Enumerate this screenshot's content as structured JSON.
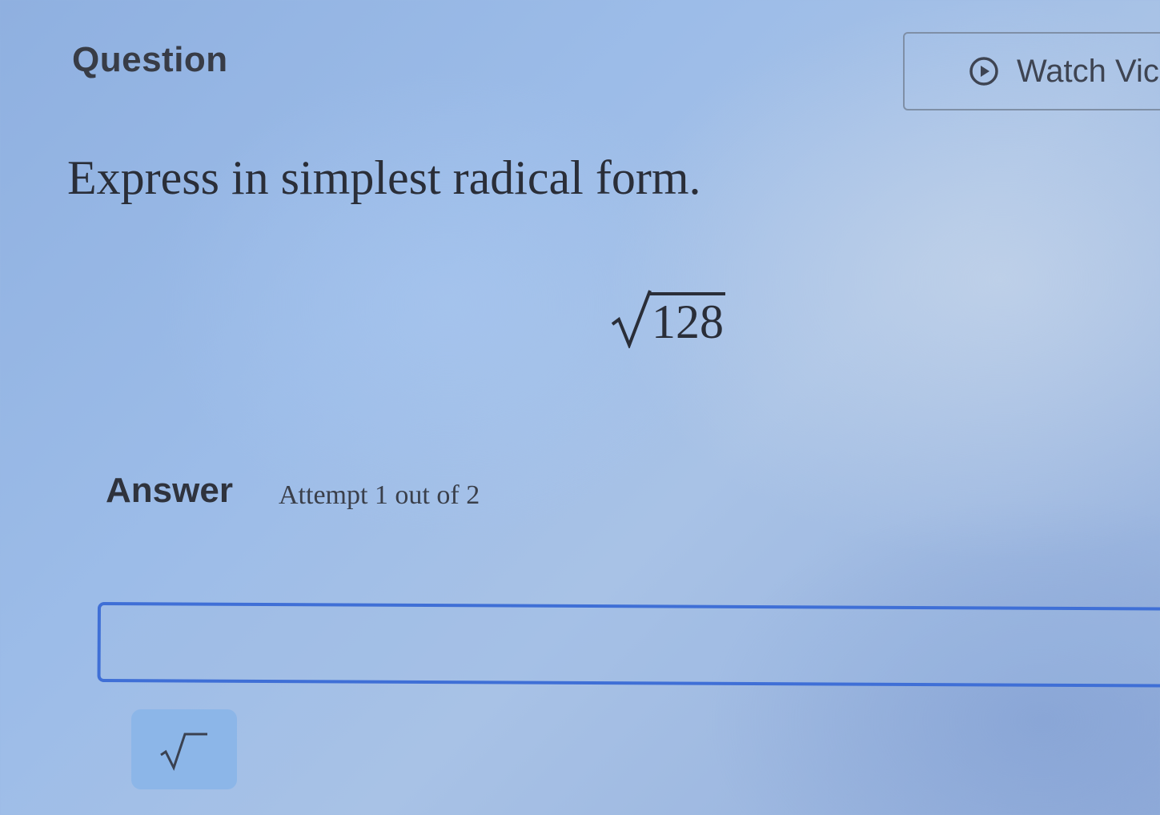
{
  "header": {
    "title": "Question",
    "watch_video_label": "Watch Vic"
  },
  "question": {
    "prompt": "Express in simplest radical form.",
    "radicand": "128"
  },
  "answer": {
    "label": "Answer",
    "attempt_text": "Attempt 1 out of 2",
    "input_value": "",
    "input_placeholder": ""
  },
  "toolbar": {
    "sqrt_button_icon": "square-root-icon"
  },
  "colors": {
    "input_border": "#3f6fd6",
    "button_bg": "#8cb6e8"
  }
}
